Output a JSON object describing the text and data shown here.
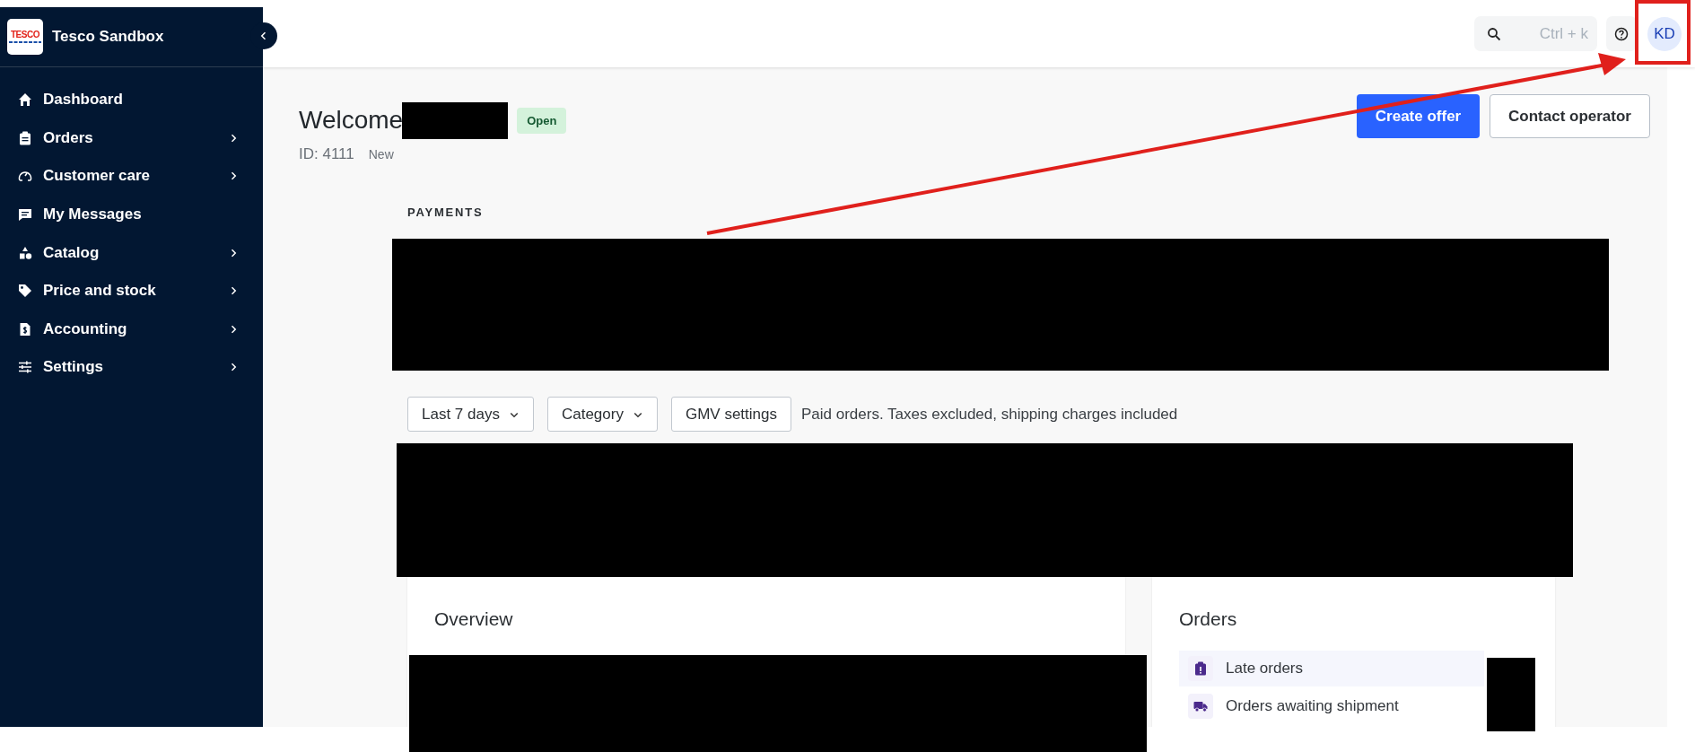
{
  "sidebar": {
    "brand": {
      "logo": "TESCO",
      "title": "Tesco Sandbox"
    },
    "items": [
      {
        "label": "Dashboard",
        "has_submenu": false
      },
      {
        "label": "Orders",
        "has_submenu": true
      },
      {
        "label": "Customer care",
        "has_submenu": true
      },
      {
        "label": "My Messages",
        "has_submenu": false
      },
      {
        "label": "Catalog",
        "has_submenu": true
      },
      {
        "label": "Price and stock",
        "has_submenu": true
      },
      {
        "label": "Accounting",
        "has_submenu": true
      },
      {
        "label": "Settings",
        "has_submenu": true
      }
    ]
  },
  "header": {
    "search": {
      "placeholder": "Ctrl + k"
    },
    "avatar": "KD"
  },
  "page": {
    "title": "Welcome",
    "status_badge": "Open",
    "id": "ID: 4111",
    "id_note": "New",
    "buttons": [
      {
        "label": "Create offer",
        "kind": "primary"
      },
      {
        "label": "Contact operator",
        "kind": "secondary"
      }
    ]
  },
  "payments": {
    "heading": "PAYMENTS"
  },
  "activity": {
    "filters": [
      {
        "label": "Last 7 days",
        "dropdown": true
      },
      {
        "label": "Category",
        "dropdown": true
      },
      {
        "label": "GMV settings",
        "dropdown": false
      }
    ],
    "note": "Paid orders. Taxes excluded, shipping charges included"
  },
  "overview": {
    "title": "Overview"
  },
  "orders": {
    "title": "Orders",
    "rows": [
      {
        "label": "Late orders"
      },
      {
        "label": "Orders awaiting shipment"
      }
    ]
  }
}
